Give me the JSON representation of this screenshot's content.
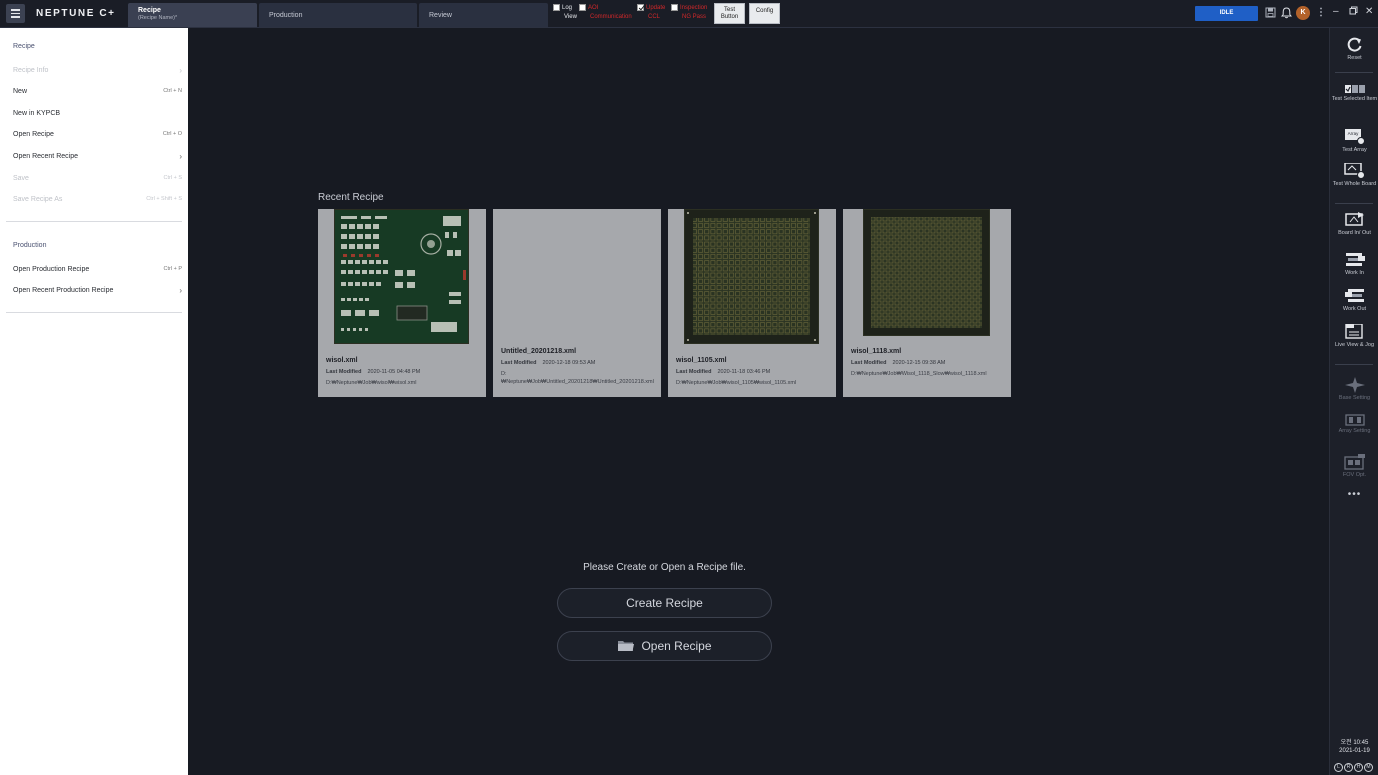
{
  "app": {
    "logo_text": "NEPTUNE C+",
    "tabs": [
      {
        "label": "Recipe",
        "sublabel": "(Recipe Name)*"
      },
      {
        "label": "Production"
      },
      {
        "label": "Review"
      }
    ],
    "toggles": [
      {
        "line1": "Log",
        "line2": "View",
        "checked": false,
        "color": "white"
      },
      {
        "line1": "AOI",
        "line2": "Communication",
        "checked": false,
        "color": "red"
      },
      {
        "line1": "Update",
        "line2": "CCL",
        "checked": true,
        "color": "red"
      },
      {
        "line1": "Inspection",
        "line2": "NG Pass",
        "checked": false,
        "color": "red"
      }
    ],
    "test_button": {
      "line1": "Test",
      "line2": "Button"
    },
    "config_button": "Config",
    "status": "IDLE",
    "avatar_initial": "K",
    "icons": [
      "save-icon",
      "bell-icon",
      "more-vertical-icon",
      "minimize-icon",
      "restore-icon",
      "close-icon"
    ]
  },
  "left_menu": {
    "recipe_section": "Recipe",
    "recipe_items": [
      {
        "label": "Recipe Info",
        "shortcut": "",
        "submenu": true,
        "disabled": true
      },
      {
        "label": "New",
        "shortcut": "Ctrl + N",
        "submenu": false,
        "disabled": false
      },
      {
        "label": "New in KYPCB",
        "shortcut": "",
        "submenu": false,
        "disabled": false
      },
      {
        "label": "Open Recipe",
        "shortcut": "Ctrl + O",
        "submenu": false,
        "disabled": false
      },
      {
        "label": "Open Recent Recipe",
        "shortcut": "",
        "submenu": true,
        "disabled": false
      },
      {
        "label": "Save",
        "shortcut": "Ctrl + S",
        "submenu": false,
        "disabled": true
      },
      {
        "label": "Save Recipe As",
        "shortcut": "Ctrl + Shift + S",
        "submenu": false,
        "disabled": true
      }
    ],
    "production_section": "Production",
    "production_items": [
      {
        "label": "Open Production Recipe",
        "shortcut": "Ctrl + P",
        "submenu": false,
        "disabled": false
      },
      {
        "label": "Open Recent Production Recipe",
        "shortcut": "",
        "submenu": true,
        "disabled": false
      }
    ]
  },
  "main": {
    "recent_title": "Recent Recipe",
    "last_modified_label": "Last Modified",
    "recipes": [
      {
        "name": "wisol.xml",
        "modified": "2020-11-05  04:48 PM",
        "path": "D:₩Neptune₩Job₩wisol₩wisol.xml",
        "thumb": "pcb-mixed"
      },
      {
        "name": "Untitled_20201218.xml",
        "modified": "2020-12-18  09:53 AM",
        "path": "D:₩Neptune₩Job₩Untitled_20201218₩Untitled_20201218.xml",
        "thumb": "none"
      },
      {
        "name": "wisol_1105.xml",
        "modified": "2020-11-18  03:46 PM",
        "path": "D:₩Neptune₩Job₩wisol_1105₩wisol_1105.xml",
        "thumb": "pcb-grid"
      },
      {
        "name": "wisol_1118.xml",
        "modified": "2020-12-15  09:38 AM",
        "path": "D:₩Neptune₩Job₩Wisol_1118_Slow₩wisol_1118.xml",
        "thumb": "pcb-grid"
      }
    ],
    "prompt": "Please Create or Open a Recipe file.",
    "create_label": "Create Recipe",
    "open_label": "Open Recipe"
  },
  "right_toolbar": {
    "items": [
      {
        "label": "Reset",
        "icon": "reset-icon",
        "disabled": false
      },
      {
        "label": "Test Selected Item",
        "icon": "test-selected-icon",
        "disabled": false
      },
      {
        "label": "Test Array",
        "icon": "test-array-icon",
        "disabled": false
      },
      {
        "label": "Test Whole Board",
        "icon": "test-board-icon",
        "disabled": false
      },
      {
        "label": "Board In/ Out",
        "icon": "board-inout-icon",
        "disabled": false
      },
      {
        "label": "Work In",
        "icon": "work-in-icon",
        "disabled": false
      },
      {
        "label": "Work Out",
        "icon": "work-out-icon",
        "disabled": false
      },
      {
        "label": "Live View & Jog",
        "icon": "live-view-icon",
        "disabled": false
      },
      {
        "label": "Base Setting",
        "icon": "base-setting-icon",
        "disabled": true
      },
      {
        "label": "Array Setting",
        "icon": "array-setting-icon",
        "disabled": true
      },
      {
        "label": "FOV Opt.",
        "icon": "fov-icon",
        "disabled": true
      }
    ],
    "time": "오전 10:45",
    "date": "2021-01-19",
    "indicators": [
      "L",
      "R",
      "H",
      "M"
    ]
  }
}
